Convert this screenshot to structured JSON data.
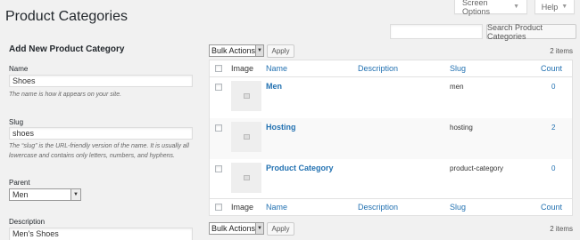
{
  "page": {
    "title": "Product Categories"
  },
  "screen_meta": {
    "screen_options": "Screen Options",
    "help": "Help"
  },
  "search": {
    "button": "Search Product Categories",
    "value": ""
  },
  "form": {
    "heading": "Add New Product Category",
    "name_label": "Name",
    "name_value": "Shoes",
    "name_hint": "The name is how it appears on your site.",
    "slug_label": "Slug",
    "slug_value": "shoes",
    "slug_hint": "The “slug” is the URL-friendly version of the name. It is usually all lowercase and contains only letters, numbers, and hyphens.",
    "parent_label": "Parent",
    "parent_value": "Men",
    "description_label": "Description",
    "description_value": "Men's Shoes"
  },
  "list": {
    "bulk_actions": "Bulk Actions",
    "apply": "Apply",
    "items_count": "2 items",
    "columns": {
      "image": "Image",
      "name": "Name",
      "description": "Description",
      "slug": "Slug",
      "count": "Count"
    },
    "rows": [
      {
        "name": "Men",
        "description": "",
        "slug": "men",
        "count": "0"
      },
      {
        "name": "Hosting",
        "description": "",
        "slug": "hosting",
        "count": "2"
      },
      {
        "name": "Product Category",
        "description": "",
        "slug": "product-category",
        "count": "0"
      }
    ]
  },
  "colors": {
    "link": "#2271b1",
    "background": "#f1f1f1"
  }
}
